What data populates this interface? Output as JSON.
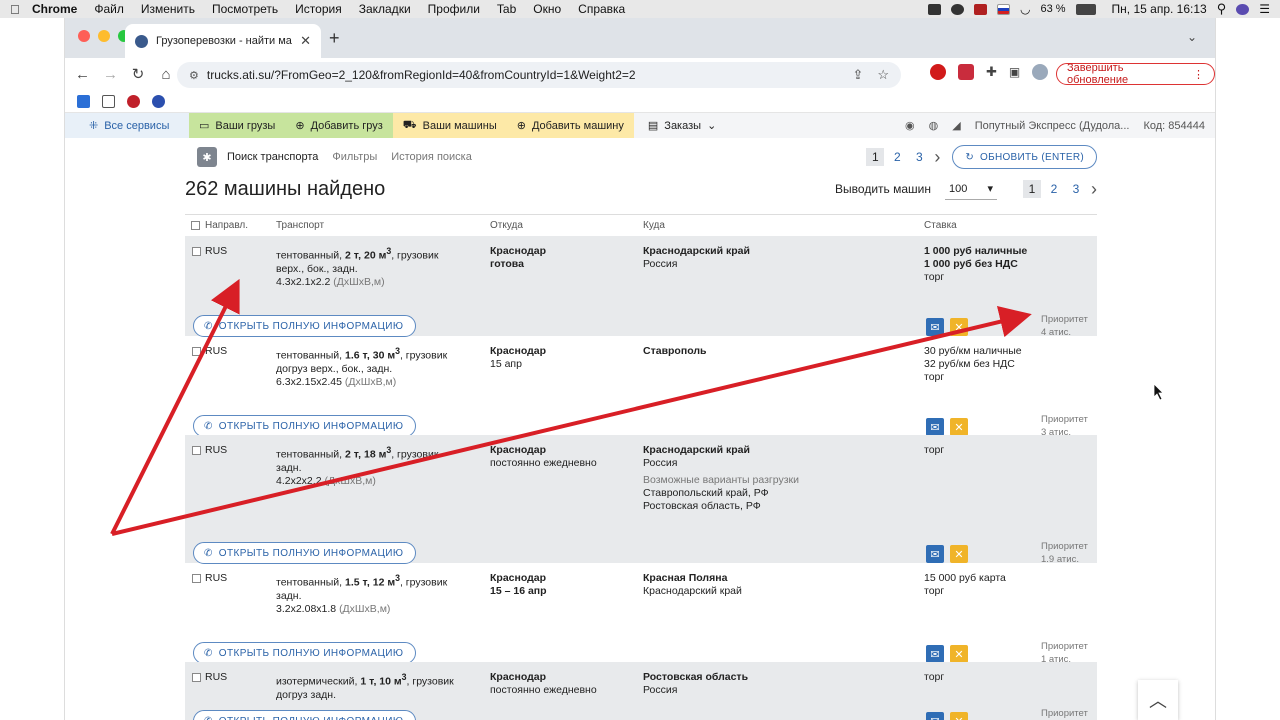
{
  "menubar": {
    "app": "Chrome",
    "items": [
      "Файл",
      "Изменить",
      "Посмотреть",
      "История",
      "Закладки",
      "Профили",
      "Tab",
      "Окно",
      "Справка"
    ],
    "battery": "63 %",
    "datetime": "Пн, 15 апр.  16:13"
  },
  "browser": {
    "tab_title": "Грузоперевозки - найти маш",
    "url": "trucks.ati.su/?FromGeo=2_120&fromRegionId=40&fromCountryId=1&Weight2=2",
    "update_button": "Завершить обновление"
  },
  "site_nav": {
    "all_services": "Все сервисы",
    "your_cargo": "Ваши грузы",
    "add_cargo": "Добавить груз",
    "your_trucks": "Ваши машины",
    "add_truck": "Добавить машину",
    "orders": "Заказы",
    "company": "Попутный Экспресс (Дудола...",
    "code": "Код: 854444"
  },
  "search": {
    "tab_active": "Поиск транспорта",
    "tab_filters": "Фильтры",
    "tab_history": "История поиска",
    "pages": [
      "1",
      "2",
      "3"
    ],
    "refresh": "ОБНОВИТЬ (ENTER)",
    "found": "262 машины найдено",
    "per_page_label": "Выводить машин",
    "per_page": "100"
  },
  "table": {
    "headers": {
      "dir": "Направл.",
      "transport": "Транспорт",
      "from": "Откуда",
      "to": "Куда",
      "rate": "Ставка"
    },
    "open_button": "ОТКРЫТЬ ПОЛНУЮ ИНФОРМАЦИЮ",
    "priority_label": "Приоритет",
    "rows": [
      {
        "dir": "RUS",
        "t1": "тентованный, ",
        "tw": "2 т",
        "tv": ", 20 м",
        "t1b": ", грузовик",
        "t2": "верх., бок., задн.",
        "dims": "4.3x2.1x2.2",
        "dims_unit": "(ДхШхВ,м)",
        "from_city": "Краснодар",
        "from_when": "готова",
        "to_main": "Краснодарский край",
        "to_sub": "Россия",
        "rate1": "1 000 руб наличные",
        "rate2": "1 000 руб без НДС",
        "rate3": "торг",
        "priority": "4 атис."
      },
      {
        "dir": "RUS",
        "t1": "тентованный, ",
        "tw": "1.6 т",
        "tv": ", 30 м",
        "t1b": ", грузовик",
        "t2": "догруз верх., бок., задн.",
        "dims": "6.3x2.15x2.45",
        "dims_unit": "(ДхШхВ,м)",
        "from_city": "Краснодар",
        "from_when": "15 апр",
        "to_main": "Ставрополь",
        "to_sub": "",
        "rate1": "30 руб/км наличные",
        "rate2": "32 руб/км без НДС",
        "rate3": "торг",
        "priority": "3 атис."
      },
      {
        "dir": "RUS",
        "t1": "тентованный, ",
        "tw": "2 т",
        "tv": ", 18 м",
        "t1b": ", грузовик",
        "t2": "задн.",
        "dims": "4.2x2x2.2",
        "dims_unit": "(ДхШхВ,м)",
        "from_city": "Краснодар",
        "from_when": "постоянно ежедневно",
        "to_main": "Краснодарский край",
        "to_sub": "Россия",
        "to_alt_label": "Возможные варианты разгрузки",
        "to_alt1": "Ставропольский край, РФ",
        "to_alt2": "Ростовская область, РФ",
        "rate1": "торг",
        "rate2": "",
        "rate3": "",
        "priority": "1.9 атис."
      },
      {
        "dir": "RUS",
        "t1": "тентованный, ",
        "tw": "1.5 т",
        "tv": ", 12 м",
        "t1b": ", грузовик",
        "t2": "задн.",
        "dims": "3.2x2.08x1.8",
        "dims_unit": "(ДхШхВ,м)",
        "from_city": "Краснодар",
        "from_when": "15  – 16 апр",
        "to_main": "Красная Поляна",
        "to_sub": "Краснодарский край",
        "rate1": "15 000 руб карта",
        "rate2": "торг",
        "rate3": "",
        "priority": "1 атис."
      },
      {
        "dir": "RUS",
        "t1": "изотермический, ",
        "tw": "1 т",
        "tv": ", 10 м",
        "t1b": ", грузовик",
        "t2": "догруз задн.",
        "dims": "",
        "dims_unit": "",
        "from_city": "Краснодар",
        "from_when": "постоянно ежедневно",
        "to_main": "Ростовская область",
        "to_sub": "Россия",
        "rate1": "торг",
        "rate2": "",
        "rate3": "",
        "priority": ""
      }
    ]
  },
  "colors": {
    "accent": "#2a62a8",
    "arrow": "#d81f26",
    "row_gray": "#e8eaec",
    "green_tab": "#c7e49d",
    "yellow_tab": "#fde9a7"
  }
}
